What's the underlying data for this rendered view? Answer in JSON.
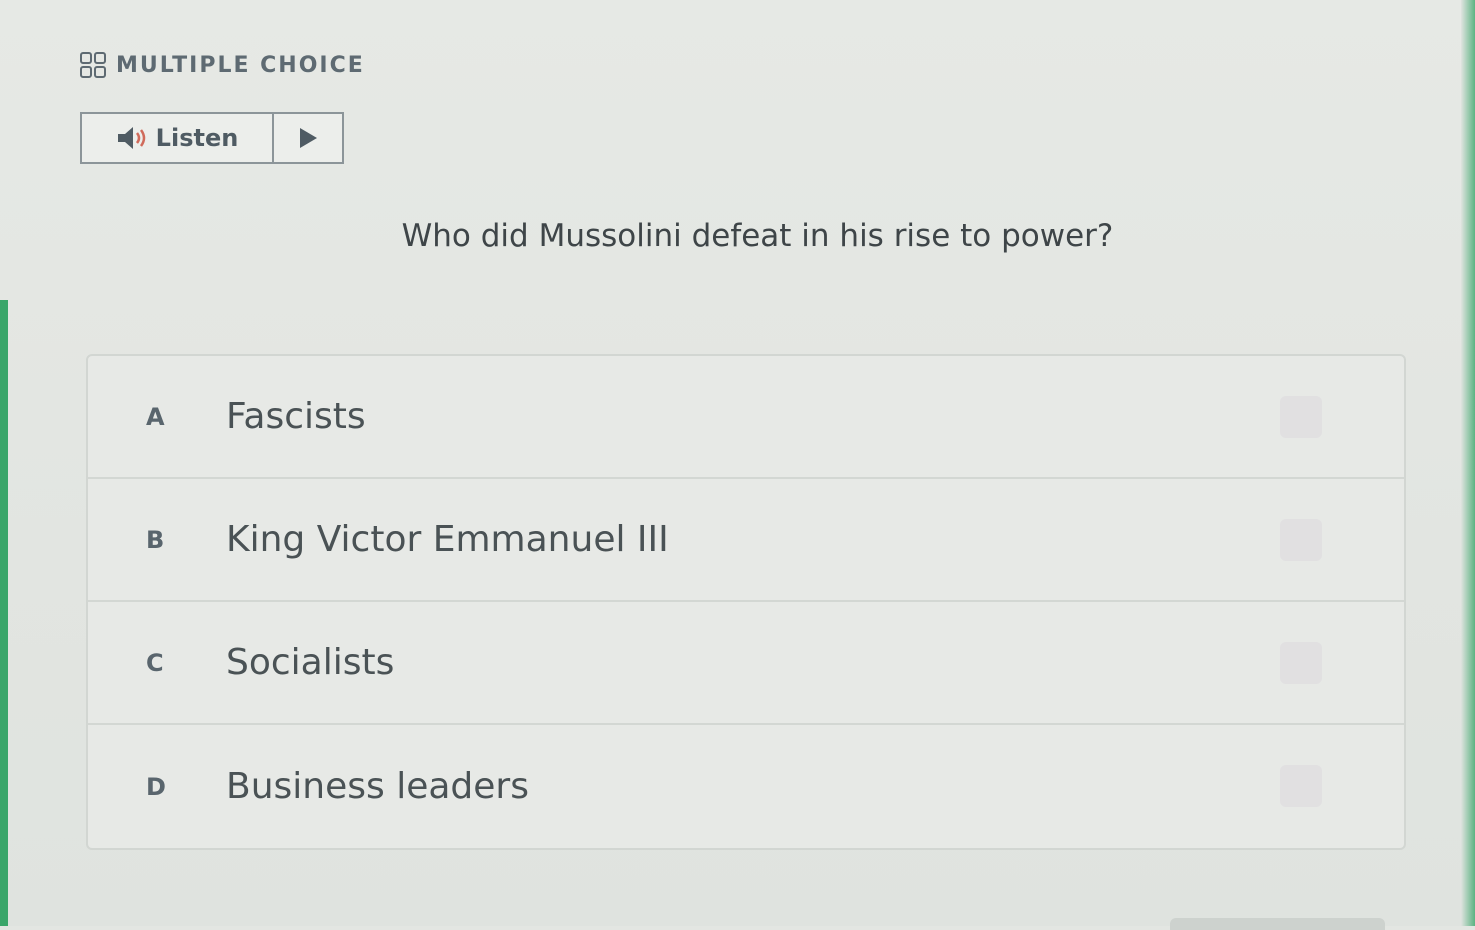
{
  "header": {
    "label": "MULTIPLE CHOICE",
    "icon": "grid-icon"
  },
  "listen": {
    "label": "Listen",
    "speaker_icon": "speaker-icon",
    "play_icon": "play-icon"
  },
  "question": {
    "text": "Who did Mussolini defeat in his rise to power?"
  },
  "choices": [
    {
      "letter": "A",
      "text": "Fascists"
    },
    {
      "letter": "B",
      "text": "King Victor Emmanuel III"
    },
    {
      "letter": "C",
      "text": "Socialists"
    },
    {
      "letter": "D",
      "text": "Business leaders"
    }
  ],
  "colors": {
    "accent": "#3aa66a",
    "text": "#4a5255",
    "muted": "#5e6a72"
  }
}
